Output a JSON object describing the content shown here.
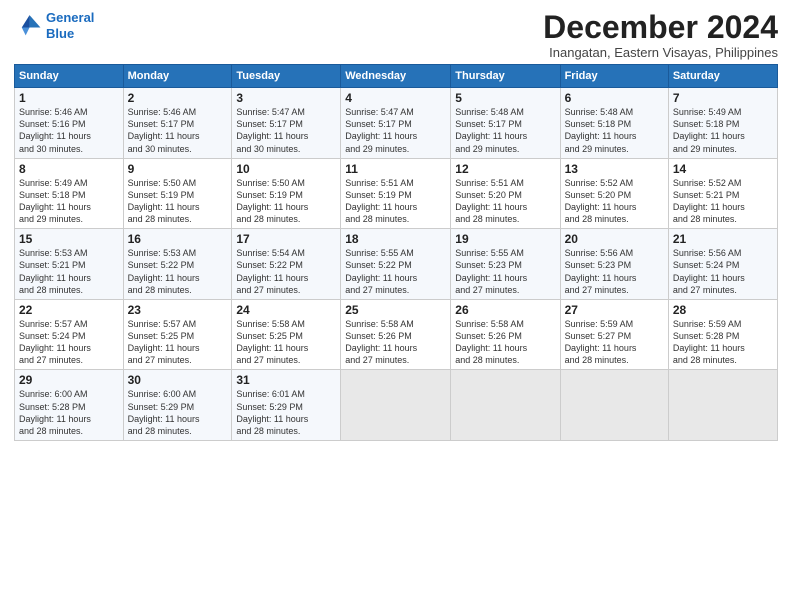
{
  "header": {
    "logo_line1": "General",
    "logo_line2": "Blue",
    "month_title": "December 2024",
    "subtitle": "Inangatan, Eastern Visayas, Philippines"
  },
  "days_of_week": [
    "Sunday",
    "Monday",
    "Tuesday",
    "Wednesday",
    "Thursday",
    "Friday",
    "Saturday"
  ],
  "weeks": [
    [
      {
        "day": "1",
        "info": "Sunrise: 5:46 AM\nSunset: 5:16 PM\nDaylight: 11 hours\nand 30 minutes."
      },
      {
        "day": "2",
        "info": "Sunrise: 5:46 AM\nSunset: 5:17 PM\nDaylight: 11 hours\nand 30 minutes."
      },
      {
        "day": "3",
        "info": "Sunrise: 5:47 AM\nSunset: 5:17 PM\nDaylight: 11 hours\nand 30 minutes."
      },
      {
        "day": "4",
        "info": "Sunrise: 5:47 AM\nSunset: 5:17 PM\nDaylight: 11 hours\nand 29 minutes."
      },
      {
        "day": "5",
        "info": "Sunrise: 5:48 AM\nSunset: 5:17 PM\nDaylight: 11 hours\nand 29 minutes."
      },
      {
        "day": "6",
        "info": "Sunrise: 5:48 AM\nSunset: 5:18 PM\nDaylight: 11 hours\nand 29 minutes."
      },
      {
        "day": "7",
        "info": "Sunrise: 5:49 AM\nSunset: 5:18 PM\nDaylight: 11 hours\nand 29 minutes."
      }
    ],
    [
      {
        "day": "8",
        "info": "Sunrise: 5:49 AM\nSunset: 5:18 PM\nDaylight: 11 hours\nand 29 minutes."
      },
      {
        "day": "9",
        "info": "Sunrise: 5:50 AM\nSunset: 5:19 PM\nDaylight: 11 hours\nand 28 minutes."
      },
      {
        "day": "10",
        "info": "Sunrise: 5:50 AM\nSunset: 5:19 PM\nDaylight: 11 hours\nand 28 minutes."
      },
      {
        "day": "11",
        "info": "Sunrise: 5:51 AM\nSunset: 5:19 PM\nDaylight: 11 hours\nand 28 minutes."
      },
      {
        "day": "12",
        "info": "Sunrise: 5:51 AM\nSunset: 5:20 PM\nDaylight: 11 hours\nand 28 minutes."
      },
      {
        "day": "13",
        "info": "Sunrise: 5:52 AM\nSunset: 5:20 PM\nDaylight: 11 hours\nand 28 minutes."
      },
      {
        "day": "14",
        "info": "Sunrise: 5:52 AM\nSunset: 5:21 PM\nDaylight: 11 hours\nand 28 minutes."
      }
    ],
    [
      {
        "day": "15",
        "info": "Sunrise: 5:53 AM\nSunset: 5:21 PM\nDaylight: 11 hours\nand 28 minutes."
      },
      {
        "day": "16",
        "info": "Sunrise: 5:53 AM\nSunset: 5:22 PM\nDaylight: 11 hours\nand 28 minutes."
      },
      {
        "day": "17",
        "info": "Sunrise: 5:54 AM\nSunset: 5:22 PM\nDaylight: 11 hours\nand 27 minutes."
      },
      {
        "day": "18",
        "info": "Sunrise: 5:55 AM\nSunset: 5:22 PM\nDaylight: 11 hours\nand 27 minutes."
      },
      {
        "day": "19",
        "info": "Sunrise: 5:55 AM\nSunset: 5:23 PM\nDaylight: 11 hours\nand 27 minutes."
      },
      {
        "day": "20",
        "info": "Sunrise: 5:56 AM\nSunset: 5:23 PM\nDaylight: 11 hours\nand 27 minutes."
      },
      {
        "day": "21",
        "info": "Sunrise: 5:56 AM\nSunset: 5:24 PM\nDaylight: 11 hours\nand 27 minutes."
      }
    ],
    [
      {
        "day": "22",
        "info": "Sunrise: 5:57 AM\nSunset: 5:24 PM\nDaylight: 11 hours\nand 27 minutes."
      },
      {
        "day": "23",
        "info": "Sunrise: 5:57 AM\nSunset: 5:25 PM\nDaylight: 11 hours\nand 27 minutes."
      },
      {
        "day": "24",
        "info": "Sunrise: 5:58 AM\nSunset: 5:25 PM\nDaylight: 11 hours\nand 27 minutes."
      },
      {
        "day": "25",
        "info": "Sunrise: 5:58 AM\nSunset: 5:26 PM\nDaylight: 11 hours\nand 27 minutes."
      },
      {
        "day": "26",
        "info": "Sunrise: 5:58 AM\nSunset: 5:26 PM\nDaylight: 11 hours\nand 28 minutes."
      },
      {
        "day": "27",
        "info": "Sunrise: 5:59 AM\nSunset: 5:27 PM\nDaylight: 11 hours\nand 28 minutes."
      },
      {
        "day": "28",
        "info": "Sunrise: 5:59 AM\nSunset: 5:28 PM\nDaylight: 11 hours\nand 28 minutes."
      }
    ],
    [
      {
        "day": "29",
        "info": "Sunrise: 6:00 AM\nSunset: 5:28 PM\nDaylight: 11 hours\nand 28 minutes."
      },
      {
        "day": "30",
        "info": "Sunrise: 6:00 AM\nSunset: 5:29 PM\nDaylight: 11 hours\nand 28 minutes."
      },
      {
        "day": "31",
        "info": "Sunrise: 6:01 AM\nSunset: 5:29 PM\nDaylight: 11 hours\nand 28 minutes."
      },
      null,
      null,
      null,
      null
    ]
  ]
}
